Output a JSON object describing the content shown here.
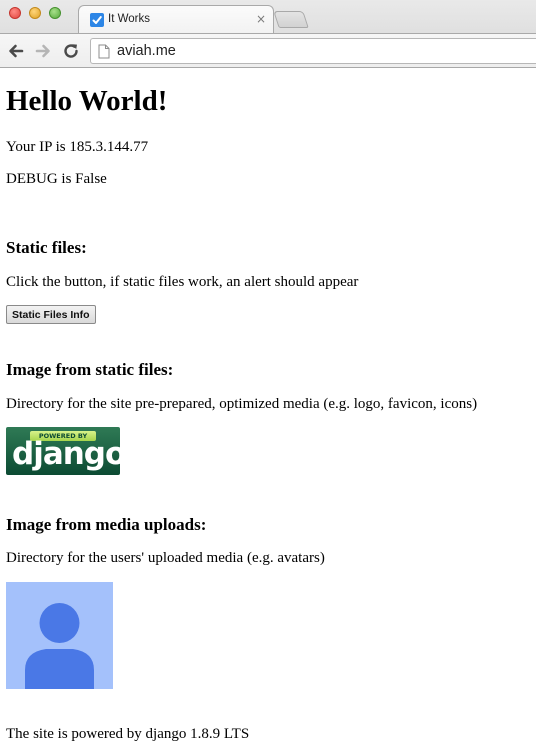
{
  "browser": {
    "tab_title": "It Works",
    "tab_close": "×",
    "url": "aviah.me"
  },
  "page": {
    "heading": "Hello World!",
    "ip_line": "Your IP is 185.3.144.77",
    "debug_line": "DEBUG is False",
    "static_files": {
      "heading": "Static files:",
      "description": "Click the button, if static files work, an alert should appear",
      "button_label": "Static Files Info"
    },
    "static_image": {
      "heading": "Image from static files:",
      "description": "Directory for the site pre-prepared, optimized media (e.g. logo, favicon, icons)",
      "badge_top": "POWERED BY",
      "badge_word": "django"
    },
    "media_image": {
      "heading": "Image from media uploads:",
      "description": "Directory for the users' uploaded media (e.g. avatars)"
    },
    "footer": "The site is powered by django 1.8.9 LTS"
  },
  "colors": {
    "favicon": "#2d86e6",
    "django_green": "#0c4b33",
    "django_lime": "#b6df5f",
    "avatar_bg": "#a4c1fb",
    "avatar_figure": "#4a78e6"
  },
  "icons": [
    "checkmark-favicon-icon",
    "close-icon",
    "back-arrow-icon",
    "forward-arrow-icon",
    "reload-icon",
    "page-icon",
    "default-avatar-icon"
  ]
}
